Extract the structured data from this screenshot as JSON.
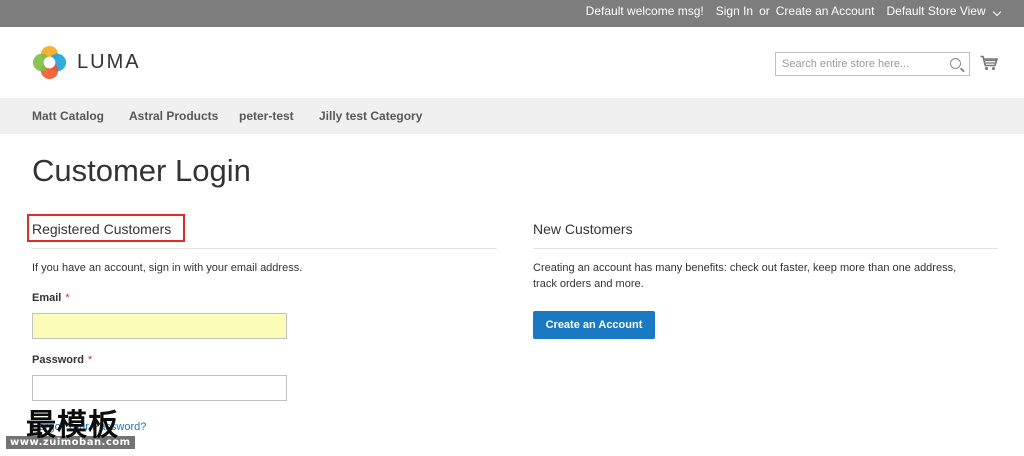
{
  "topbar": {
    "welcome": "Default welcome msg!",
    "sign_in": "Sign In",
    "or": "or",
    "create_account": "Create an Account",
    "store_view": "Default Store View"
  },
  "header": {
    "logo_text": "LUMA",
    "search_placeholder": "Search entire store here...",
    "search_value": "",
    "cart_icon": "shopping-cart-icon",
    "search_icon": "magnifier-icon"
  },
  "nav": {
    "items": [
      {
        "label": "Matt Catalog"
      },
      {
        "label": "Astral Products"
      },
      {
        "label": "peter-test"
      },
      {
        "label": "Jilly test Category"
      }
    ]
  },
  "main": {
    "page_title": "Customer Login",
    "registered": {
      "title": "Registered Customers",
      "note": "If you have an account, sign in with your email address.",
      "email_label": "Email",
      "email_value": "",
      "password_label": "Password",
      "password_value": "",
      "required_mark": "*",
      "forgot_link": "Forgot Your Password?"
    },
    "new_customers": {
      "title": "New Customers",
      "note": "Creating an account has many benefits: check out faster, keep more than one address, track orders and more.",
      "button": "Create an Account"
    }
  },
  "watermark": {
    "chinese": "最模板",
    "url": "www.zuimoban.com"
  },
  "colors": {
    "topbar_bg": "#7d7d7d",
    "nav_bg": "#f0f0f0",
    "primary_button": "#1979c3",
    "required": "#e02b27",
    "highlight_box": "#e02b27",
    "autofill_bg": "#fafcb8"
  }
}
